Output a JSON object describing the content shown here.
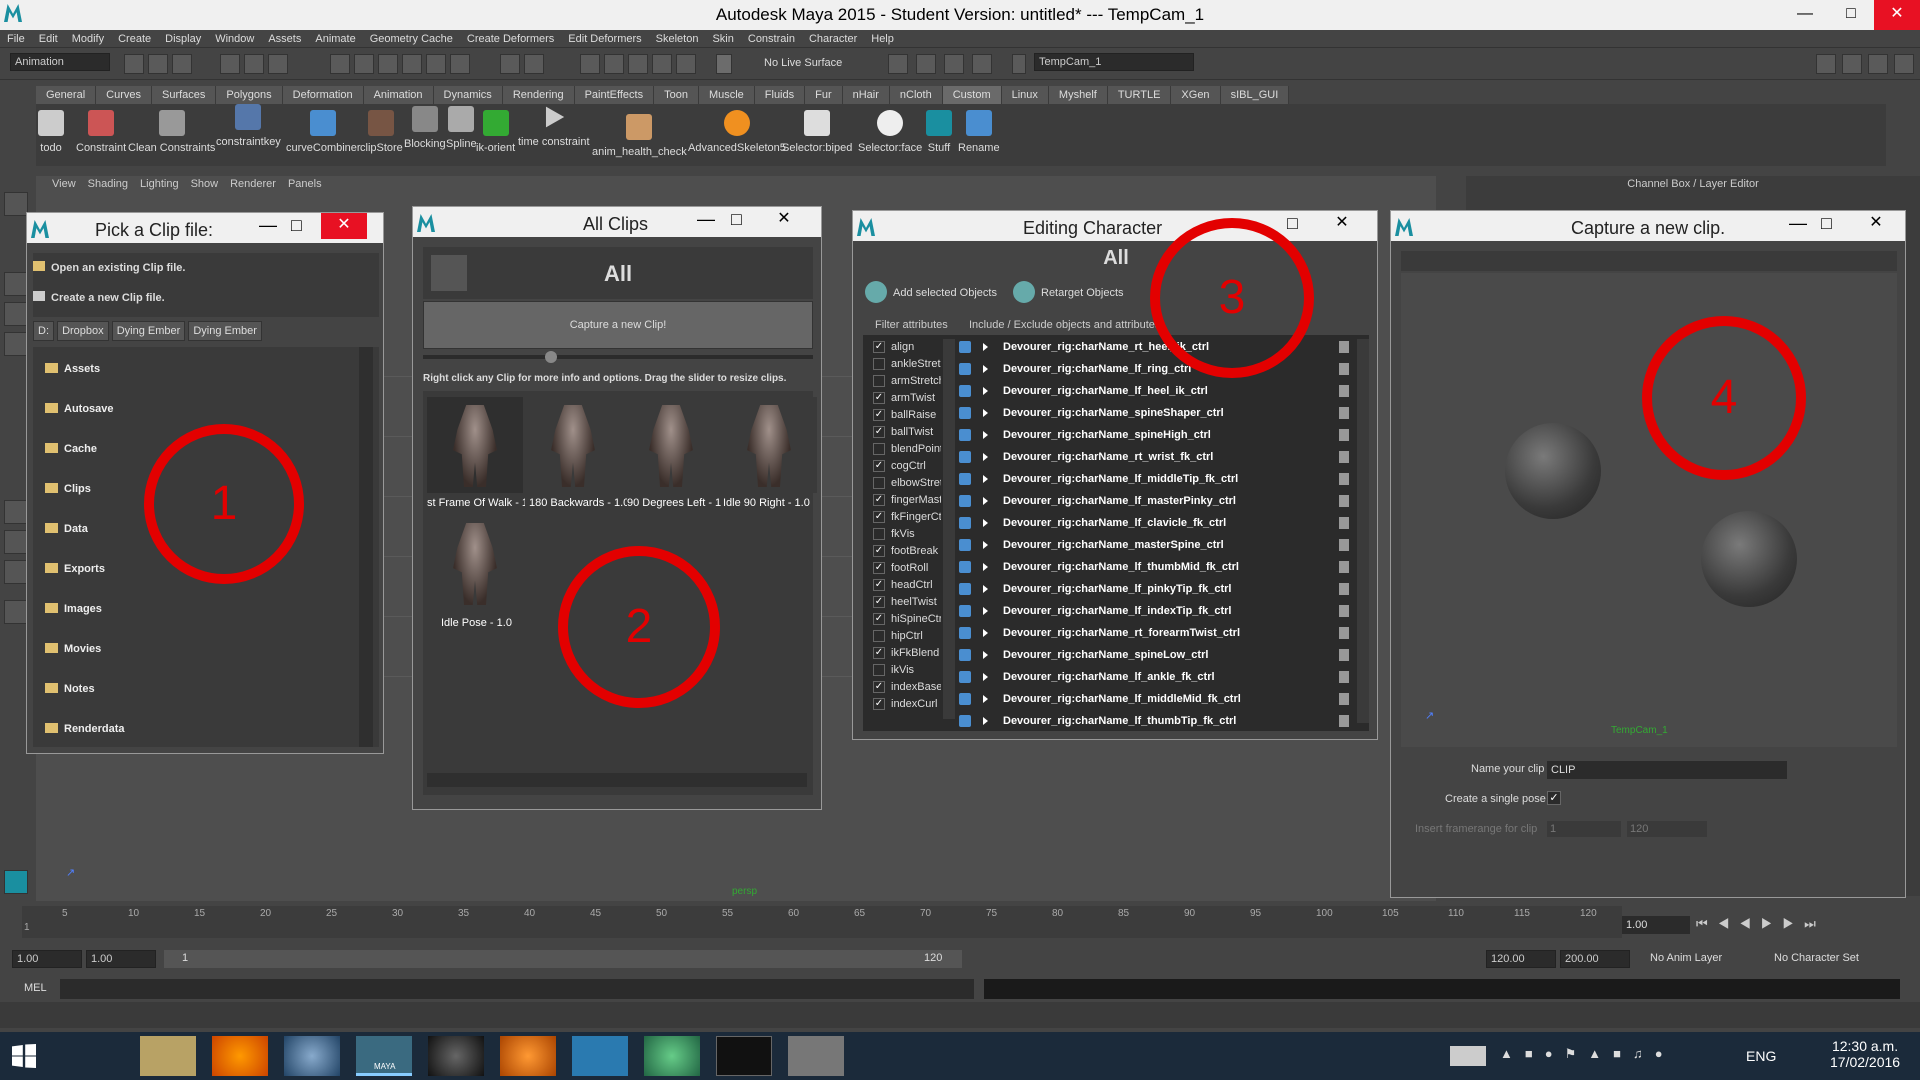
{
  "app": {
    "title": "Autodesk Maya 2015 - Student Version: untitled*   ---   TempCam_1",
    "menu": [
      "File",
      "Edit",
      "Modify",
      "Create",
      "Display",
      "Window",
      "Assets",
      "Animate",
      "Geometry Cache",
      "Create Deformers",
      "Edit Deformers",
      "Skeleton",
      "Skin",
      "Constrain",
      "Character",
      "Help"
    ],
    "menu_set": "Animation",
    "live_surface": "No Live Surface",
    "camera_field": "TempCam_1"
  },
  "shelf": {
    "tabs": [
      "General",
      "Curves",
      "Surfaces",
      "Polygons",
      "Deformation",
      "Animation",
      "Dynamics",
      "Rendering",
      "PaintEffects",
      "Toon",
      "Muscle",
      "Fluids",
      "Fur",
      "nHair",
      "nCloth",
      "Custom",
      "Linux",
      "Myshelf",
      "TURTLE",
      "XGen",
      "sIBL_GUI"
    ],
    "active_tab": "Custom",
    "buttons": [
      "todo",
      "Constraint",
      "Clean Constraints",
      "constraintkey",
      "curveCombiner",
      "clipStore",
      "Blocking",
      "Spline",
      "ik-orient",
      "time constraint",
      "anim_health_check",
      "AdvancedSkeleton5",
      "Selector:biped",
      "Selector:face",
      "Stuff",
      "Rename"
    ]
  },
  "panel_menu": [
    "View",
    "Shading",
    "Lighting",
    "Show",
    "Renderer",
    "Panels"
  ],
  "channel_box": {
    "title": "Channel Box / Layer Editor"
  },
  "viewport": {
    "camera_label": "persp"
  },
  "pick_clip": {
    "title": "Pick a Clip file:",
    "open": "Open an existing Clip file.",
    "create": "Create a new Clip file.",
    "crumbs": [
      "D:",
      "Dropbox",
      "Dying Ember",
      "Dying Ember"
    ],
    "folders": [
      "Assets",
      "Autosave",
      "Cache",
      "Clips",
      "Data",
      "Exports",
      "Images",
      "Movies",
      "Notes",
      "Renderdata"
    ]
  },
  "all_clips": {
    "title": "All Clips",
    "header": "All",
    "capture_button": "Capture a new Clip!",
    "hint": "Right click any Clip for more info and options. Drag the slider to resize clips.",
    "clips": [
      "st Frame Of Walk - 1.0",
      "180 Backwards - 1.0",
      "90 Degrees Left - 1.0",
      "Idle 90 Right - 1.0",
      "Idle Pose - 1.0"
    ]
  },
  "editing_character": {
    "title": "Editing Character :: All",
    "header": "All",
    "add_selected": "Add selected Objects",
    "retarget": "Retarget Objects",
    "filter_label": "Filter attributes",
    "include_label": "Include / Exclude objects and attributes",
    "attributes": [
      {
        "name": "align",
        "checked": true
      },
      {
        "name": "ankleStretch",
        "checked": false
      },
      {
        "name": "armStretch",
        "checked": false
      },
      {
        "name": "armTwist",
        "checked": true
      },
      {
        "name": "ballRaise",
        "checked": true
      },
      {
        "name": "ballTwist",
        "checked": true
      },
      {
        "name": "blendPoint",
        "checked": false
      },
      {
        "name": "cogCtrl",
        "checked": true
      },
      {
        "name": "elbowStretch",
        "checked": false
      },
      {
        "name": "fingerMast",
        "checked": true
      },
      {
        "name": "fkFingerCtrl",
        "checked": true
      },
      {
        "name": "fkVis",
        "checked": false
      },
      {
        "name": "footBreak",
        "checked": true
      },
      {
        "name": "footRoll",
        "checked": true
      },
      {
        "name": "headCtrl",
        "checked": true
      },
      {
        "name": "heelTwist",
        "checked": true
      },
      {
        "name": "hiSpineCtrl",
        "checked": true
      },
      {
        "name": "hipCtrl",
        "checked": false
      },
      {
        "name": "ikFkBlend",
        "checked": true
      },
      {
        "name": "ikVis",
        "checked": false
      },
      {
        "name": "indexBase",
        "checked": true
      },
      {
        "name": "indexCurl",
        "checked": true
      }
    ],
    "objects": [
      "Devourer_rig:charName_rt_heel_ik_ctrl",
      "Devourer_rig:charName_lf_ring_ctrl",
      "Devourer_rig:charName_lf_heel_ik_ctrl",
      "Devourer_rig:charName_spineShaper_ctrl",
      "Devourer_rig:charName_spineHigh_ctrl",
      "Devourer_rig:charName_rt_wrist_fk_ctrl",
      "Devourer_rig:charName_lf_middleTip_fk_ctrl",
      "Devourer_rig:charName_lf_masterPinky_ctrl",
      "Devourer_rig:charName_lf_clavicle_fk_ctrl",
      "Devourer_rig:charName_masterSpine_ctrl",
      "Devourer_rig:charName_lf_thumbMid_fk_ctrl",
      "Devourer_rig:charName_lf_pinkyTip_fk_ctrl",
      "Devourer_rig:charName_lf_indexTip_fk_ctrl",
      "Devourer_rig:charName_rt_forearmTwist_ctrl",
      "Devourer_rig:charName_spineLow_ctrl",
      "Devourer_rig:charName_lf_ankle_fk_ctrl",
      "Devourer_rig:charName_lf_middleMid_fk_ctrl",
      "Devourer_rig:charName_lf_thumbTip_fk_ctrl"
    ]
  },
  "capture_clip": {
    "title": "Capture a new clip.",
    "camera": "TempCam_1",
    "name_label": "Name your clip",
    "name_value": "CLIP",
    "single_pose_label": "Create a single pose",
    "single_pose_checked": "✓",
    "framerange_label": "Insert framerange for clip",
    "frame_start": "1",
    "frame_end": "120"
  },
  "annotations": [
    "1",
    "2",
    "3",
    "4"
  ],
  "timeline": {
    "ticks": [
      "1",
      "5",
      "10",
      "15",
      "20",
      "25",
      "30",
      "35",
      "40",
      "45",
      "50",
      "55",
      "60",
      "65",
      "70",
      "75",
      "80",
      "85",
      "90",
      "95",
      "100",
      "105",
      "110",
      "115",
      "120"
    ],
    "current_frame": "1.00"
  },
  "range": {
    "start": "1.00",
    "start2": "1.00",
    "slider_start": "1",
    "slider_end": "120",
    "end": "120.00",
    "end2": "200.00",
    "anim_layer": "No Anim Layer",
    "char_set": "No Character Set"
  },
  "cmdline": {
    "label": "MEL"
  },
  "taskbar": {
    "language": "ENG",
    "time": "12:30 a.m.",
    "date": "17/02/2016",
    "maya_label": "MAYA"
  }
}
